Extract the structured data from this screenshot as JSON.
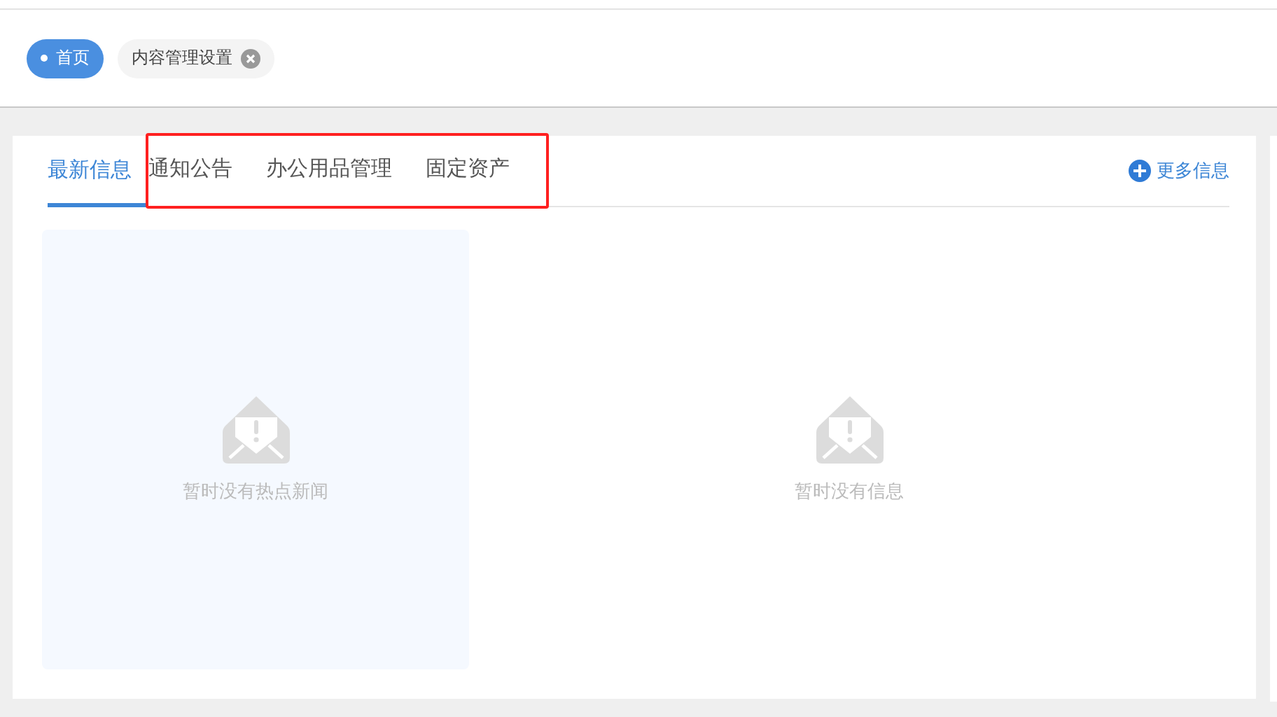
{
  "page_tabs": [
    {
      "label": "首页",
      "selected": true,
      "closable": false
    },
    {
      "label": "内容管理设置",
      "selected": false,
      "closable": true
    }
  ],
  "tabs": [
    {
      "label": "最新信息",
      "selected": true,
      "highlighted": false
    },
    {
      "label": "通知公告",
      "selected": false,
      "highlighted": true
    },
    {
      "label": "办公用品管理",
      "selected": false,
      "highlighted": true
    },
    {
      "label": "固定资产",
      "selected": false,
      "highlighted": true
    }
  ],
  "more_link": {
    "label": "更多信息"
  },
  "panels": [
    {
      "kind": "hot",
      "message": "暂时没有热点新闻"
    },
    {
      "kind": "main",
      "message": "暂时没有信息"
    }
  ]
}
